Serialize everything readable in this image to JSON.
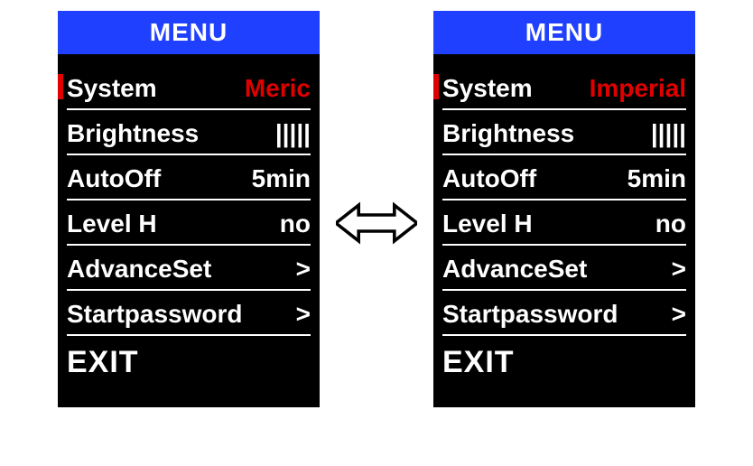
{
  "arrow_name": "toggle-arrow",
  "left": {
    "title": "MENU",
    "items": [
      {
        "label": "System",
        "value": "Meric",
        "red": true,
        "selected": true
      },
      {
        "label": "Brightness",
        "value": "|||||",
        "red": false,
        "selected": false
      },
      {
        "label": "AutoOff",
        "value": "5min",
        "red": false,
        "selected": false
      },
      {
        "label": "Level H",
        "value": "no",
        "red": false,
        "selected": false
      },
      {
        "label": "AdvanceSet",
        "value": ">",
        "red": false,
        "selected": false
      },
      {
        "label": "Startpassword",
        "value": ">",
        "red": false,
        "selected": false
      }
    ],
    "exit": "EXIT"
  },
  "right": {
    "title": "MENU",
    "items": [
      {
        "label": "System",
        "value": "Imperial",
        "red": true,
        "selected": true
      },
      {
        "label": "Brightness",
        "value": "|||||",
        "red": false,
        "selected": false
      },
      {
        "label": "AutoOff",
        "value": "5min",
        "red": false,
        "selected": false
      },
      {
        "label": "Level H",
        "value": "no",
        "red": false,
        "selected": false
      },
      {
        "label": "AdvanceSet",
        "value": ">",
        "red": false,
        "selected": false
      },
      {
        "label": "Startpassword",
        "value": ">",
        "red": false,
        "selected": false
      }
    ],
    "exit": "EXIT"
  }
}
